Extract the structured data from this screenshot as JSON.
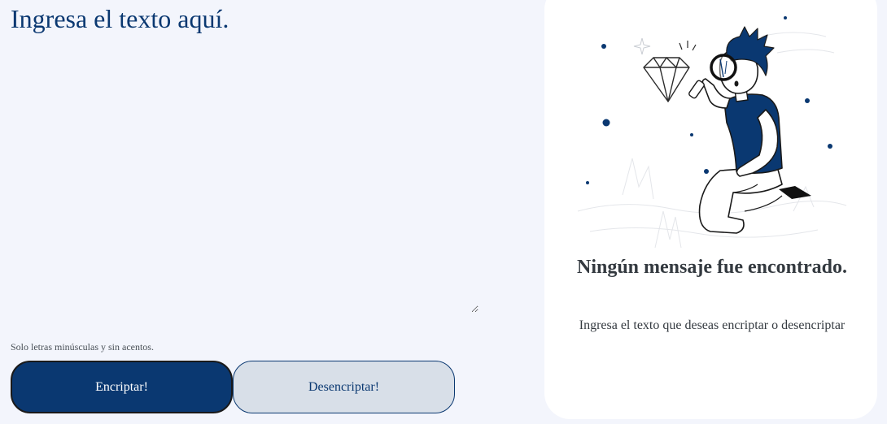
{
  "input": {
    "placeholder": "Ingresa el texto aquí."
  },
  "hint": {
    "text": "Solo letras minúsculas y sin acentos."
  },
  "buttons": {
    "encrypt_label": "Encriptar!",
    "decrypt_label": "Desencriptar!"
  },
  "output_panel": {
    "title": "Ningún mensaje fue encontrado.",
    "subtitle": "Ingresa el texto que deseas encriptar o desencriptar",
    "illustration": "person-with-magnifying-glass-illustration"
  },
  "colors": {
    "background": "#f3f5fc",
    "primary": "#0a3871",
    "secondary_button": "#d8dfe8",
    "panel": "#ffffff",
    "text_dark": "#343a40"
  }
}
